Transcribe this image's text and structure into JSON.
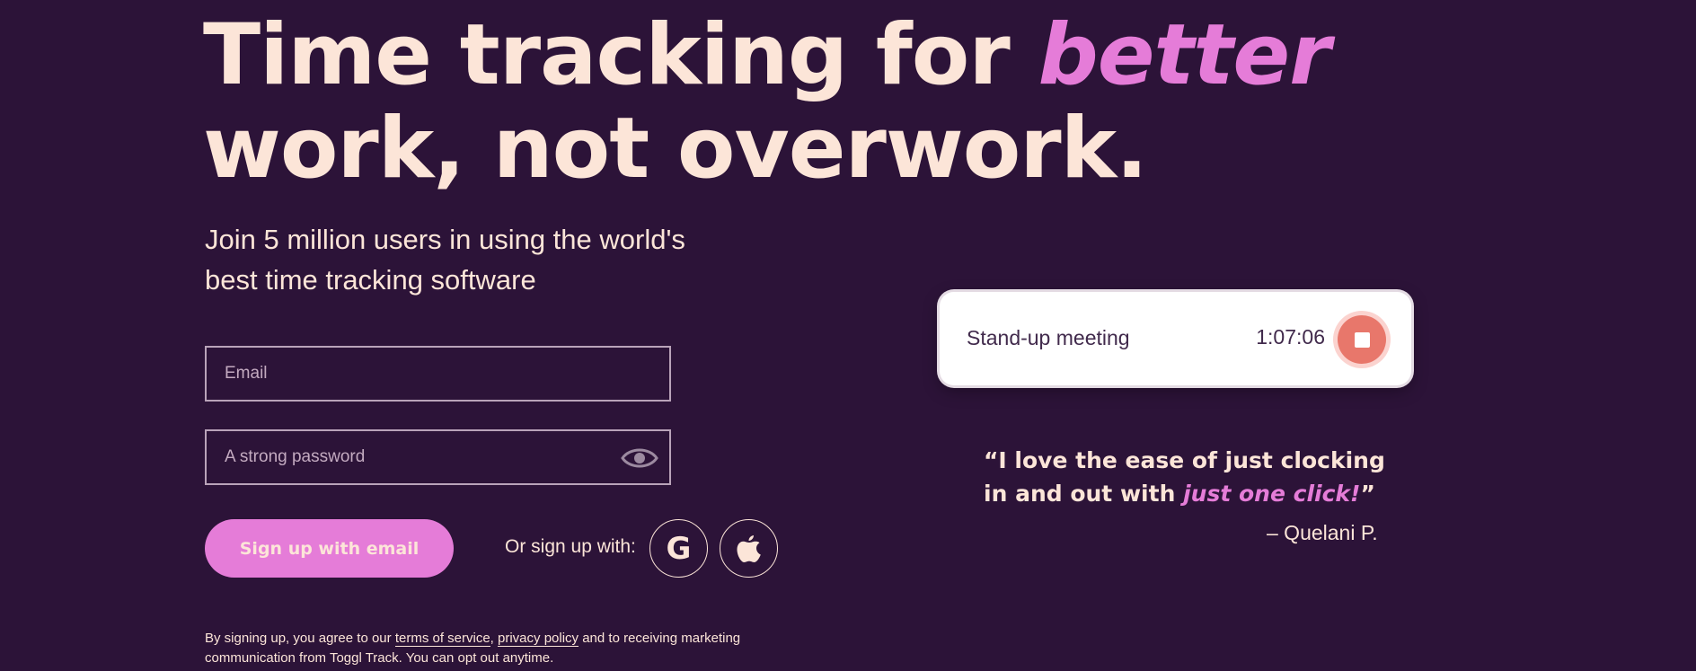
{
  "hero": {
    "headline_part1": "Time tracking for ",
    "headline_accent": "better",
    "headline_part2": "work, not overwork.",
    "subhead": "Join 5 million users in using the world's best time tracking software"
  },
  "form": {
    "email_placeholder": "Email",
    "password_placeholder": "A strong password",
    "signup_button_label": "Sign up with email",
    "or_label": "Or sign up with:",
    "google_icon": "google-icon",
    "google_glyph": "G",
    "apple_icon": "apple-icon",
    "password_toggle_icon": "eye-icon"
  },
  "legal": {
    "prefix": "By signing up, you agree to our ",
    "terms_link": "terms of service",
    "separator": ", ",
    "privacy_link": "privacy policy",
    "suffix": " and to receiving marketing communication from Toggl Track. You can opt out anytime."
  },
  "timer": {
    "task": "Stand-up meeting",
    "elapsed": "1:07:06",
    "stop_icon": "stop-icon"
  },
  "testimonial": {
    "quote_part1": "“I love the ease of just clocking in and out with ",
    "quote_accent": "just one click!",
    "quote_end": "”",
    "author": "– Quelani P."
  },
  "colors": {
    "background": "#2c1338",
    "text": "#fce5d8",
    "accent": "#e57cd8",
    "stop": "#e8776b"
  }
}
